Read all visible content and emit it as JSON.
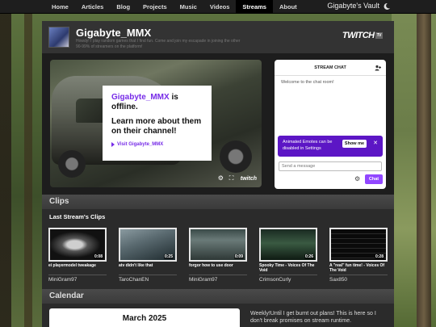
{
  "nav": {
    "items": [
      "Home",
      "Articles",
      "Blog",
      "Projects",
      "Music",
      "Videos",
      "Streams",
      "About"
    ],
    "active": "Streams",
    "site_title": "Gigabyte's Vault"
  },
  "header": {
    "channel_name": "Gigabyte_MMX",
    "description": "Howdy! I play random games that I find fun. Come and join my escapade in joining the other 90-99% of streamers on the platform!",
    "logo_text": "TWITCH",
    "logo_badge": "TV"
  },
  "player": {
    "channel_link_name": "Gigabyte_MMX",
    "status_suffix": " is offline.",
    "learn_more": "Learn more about them on their channel!",
    "visit_label": "Visit Gigabyte_MMX",
    "watermark": "twitch"
  },
  "chat": {
    "title": "STREAM CHAT",
    "welcome": "Welcome to the chat room!",
    "emote_banner": "Animated Emotes can be disabled in Settings",
    "show_me": "Show me",
    "placeholder": "Send a message",
    "send_label": "Chat"
  },
  "clips_section": {
    "heading": "Clips",
    "subheading": "Last Stream's Clips",
    "clips": [
      {
        "title": "ei playermodel tweakage",
        "duration": "0:08",
        "author": "MiniGram97"
      },
      {
        "title": "atv didn't like that",
        "duration": "0:25",
        "author": "TaroChanEN"
      },
      {
        "title": "forgor how to use door",
        "duration": "0:09",
        "author": "MiniGram97"
      },
      {
        "title": "Spooky Time - Voices Of The Void",
        "duration": "0:26",
        "author": "CrimsonCurly"
      },
      {
        "title": "A \"real\" fun time! - Voices Of The Void",
        "duration": "0:28",
        "author": "Sax850"
      }
    ]
  },
  "calendar_section": {
    "heading": "Calendar",
    "month": "March 2025",
    "note": "Weekly!Until I get burnt out plans! This is here so I don't break promises on stream runtime."
  },
  "colors": {
    "twitch_purple": "#772ce8",
    "banner_purple": "#5c16c5",
    "chat_button": "#9147ff"
  }
}
